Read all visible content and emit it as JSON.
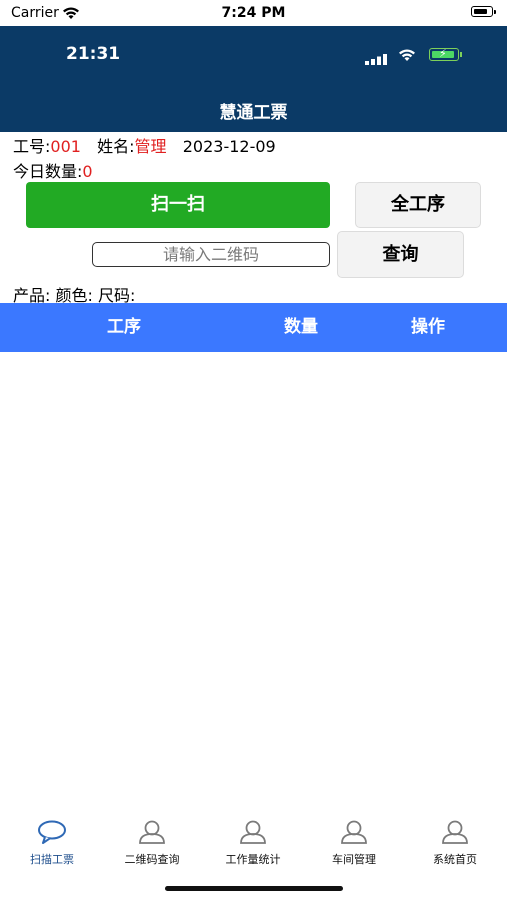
{
  "outer_status": {
    "carrier": "Carrier",
    "time": "7:24 PM"
  },
  "inner_status": {
    "time": "21:31"
  },
  "header": {
    "title": "慧通工票"
  },
  "info": {
    "job_label": "工号:",
    "job_value": "001",
    "name_label": "姓名:",
    "name_value": "管理",
    "date": "2023-12-09",
    "count_label": "今日数量:",
    "count_value": "0"
  },
  "buttons": {
    "scan": "扫一扫",
    "all_process": "全工序",
    "query": "查询"
  },
  "qr_input": {
    "placeholder": "请输入二维码",
    "value": ""
  },
  "product": {
    "product_label": "产品:",
    "color_label": "颜色:",
    "size_label": "尺码:"
  },
  "table": {
    "headers": [
      "工序",
      "数量",
      "操作"
    ]
  },
  "tabbar": {
    "items": [
      {
        "label": "扫描工票",
        "icon": "chat-bubble-icon",
        "active": true
      },
      {
        "label": "二维码查询",
        "icon": "user-icon",
        "active": false
      },
      {
        "label": "工作量统计",
        "icon": "user-icon",
        "active": false
      },
      {
        "label": "车间管理",
        "icon": "user-icon",
        "active": false
      },
      {
        "label": "系统首页",
        "icon": "user-icon",
        "active": false
      }
    ]
  },
  "colors": {
    "header_bg": "#0b3a66",
    "scan_btn": "#22aa24",
    "table_head": "#3b78ff",
    "highlight": "#e02020",
    "tab_active": "#1e4e8c"
  }
}
